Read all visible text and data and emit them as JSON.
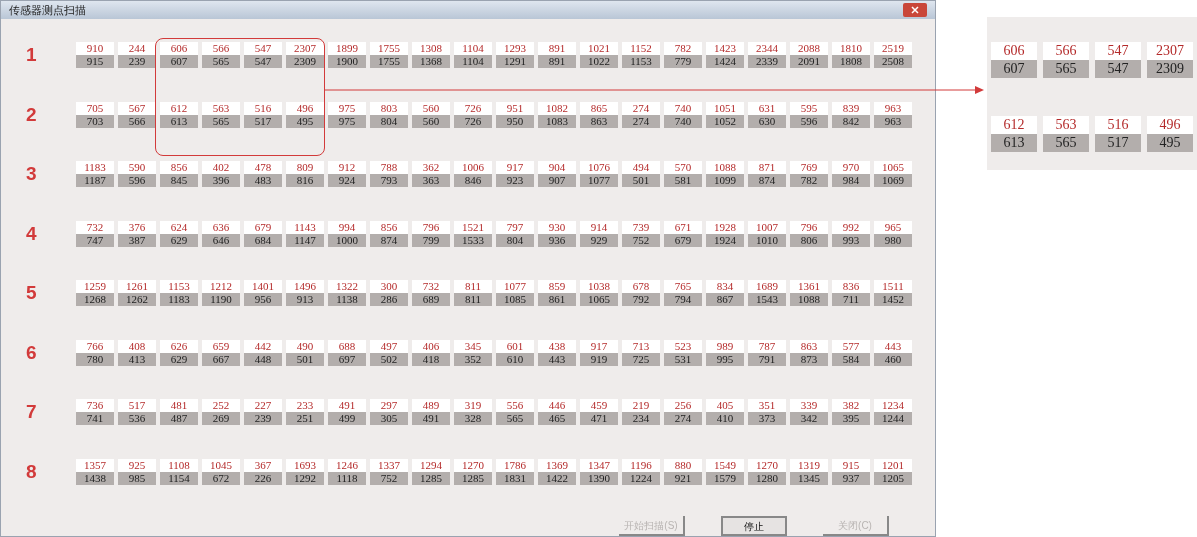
{
  "window": {
    "title": "传感器测点扫描"
  },
  "rows": [
    {
      "label": "1",
      "cells": [
        [
          "910",
          "915"
        ],
        [
          "244",
          "239"
        ],
        [
          "606",
          "607"
        ],
        [
          "566",
          "565"
        ],
        [
          "547",
          "547"
        ],
        [
          "2307",
          "2309"
        ],
        [
          "1899",
          "1900"
        ],
        [
          "1755",
          "1755"
        ],
        [
          "1308",
          "1368"
        ],
        [
          "1104",
          "1104"
        ],
        [
          "1293",
          "1291"
        ],
        [
          "891",
          "891"
        ],
        [
          "1021",
          "1022"
        ],
        [
          "1152",
          "1153"
        ],
        [
          "782",
          "779"
        ],
        [
          "1423",
          "1424"
        ],
        [
          "2344",
          "2339"
        ],
        [
          "2088",
          "2091"
        ],
        [
          "1810",
          "1808"
        ],
        [
          "2519",
          "2508"
        ]
      ]
    },
    {
      "label": "2",
      "cells": [
        [
          "705",
          "703"
        ],
        [
          "567",
          "566"
        ],
        [
          "612",
          "613"
        ],
        [
          "563",
          "565"
        ],
        [
          "516",
          "517"
        ],
        [
          "496",
          "495"
        ],
        [
          "975",
          "975"
        ],
        [
          "803",
          "804"
        ],
        [
          "560",
          "560"
        ],
        [
          "726",
          "726"
        ],
        [
          "951",
          "950"
        ],
        [
          "1082",
          "1083"
        ],
        [
          "865",
          "863"
        ],
        [
          "274",
          "274"
        ],
        [
          "740",
          "740"
        ],
        [
          "1051",
          "1052"
        ],
        [
          "631",
          "630"
        ],
        [
          "595",
          "596"
        ],
        [
          "839",
          "842"
        ],
        [
          "963",
          "963"
        ]
      ]
    },
    {
      "label": "3",
      "cells": [
        [
          "1183",
          "1187"
        ],
        [
          "590",
          "596"
        ],
        [
          "856",
          "845"
        ],
        [
          "402",
          "396"
        ],
        [
          "478",
          "483"
        ],
        [
          "809",
          "816"
        ],
        [
          "912",
          "924"
        ],
        [
          "788",
          "793"
        ],
        [
          "362",
          "363"
        ],
        [
          "1006",
          "846"
        ],
        [
          "917",
          "923"
        ],
        [
          "904",
          "907"
        ],
        [
          "1076",
          "1077"
        ],
        [
          "494",
          "501"
        ],
        [
          "570",
          "581"
        ],
        [
          "1088",
          "1099"
        ],
        [
          "871",
          "874"
        ],
        [
          "769",
          "782"
        ],
        [
          "970",
          "984"
        ],
        [
          "1065",
          "1069"
        ]
      ]
    },
    {
      "label": "4",
      "cells": [
        [
          "732",
          "747"
        ],
        [
          "376",
          "387"
        ],
        [
          "624",
          "629"
        ],
        [
          "636",
          "646"
        ],
        [
          "679",
          "684"
        ],
        [
          "1143",
          "1147"
        ],
        [
          "994",
          "1000"
        ],
        [
          "856",
          "874"
        ],
        [
          "796",
          "799"
        ],
        [
          "1521",
          "1533"
        ],
        [
          "797",
          "804"
        ],
        [
          "930",
          "936"
        ],
        [
          "914",
          "929"
        ],
        [
          "739",
          "752"
        ],
        [
          "671",
          "679"
        ],
        [
          "1928",
          "1924"
        ],
        [
          "1007",
          "1010"
        ],
        [
          "796",
          "806"
        ],
        [
          "992",
          "993"
        ],
        [
          "965",
          "980"
        ]
      ]
    },
    {
      "label": "5",
      "cells": [
        [
          "1259",
          "1268"
        ],
        [
          "1261",
          "1262"
        ],
        [
          "1153",
          "1183"
        ],
        [
          "1212",
          "1190"
        ],
        [
          "1401",
          "956"
        ],
        [
          "1496",
          "913"
        ],
        [
          "1322",
          "1138"
        ],
        [
          "300",
          "286"
        ],
        [
          "732",
          "689"
        ],
        [
          "811",
          "811"
        ],
        [
          "1077",
          "1085"
        ],
        [
          "859",
          "861"
        ],
        [
          "1038",
          "1065"
        ],
        [
          "678",
          "792"
        ],
        [
          "765",
          "794"
        ],
        [
          "834",
          "867"
        ],
        [
          "1689",
          "1543"
        ],
        [
          "1361",
          "1088"
        ],
        [
          "836",
          "711"
        ],
        [
          "1511",
          "1452"
        ]
      ]
    },
    {
      "label": "6",
      "cells": [
        [
          "766",
          "780"
        ],
        [
          "408",
          "413"
        ],
        [
          "626",
          "629"
        ],
        [
          "659",
          "667"
        ],
        [
          "442",
          "448"
        ],
        [
          "490",
          "501"
        ],
        [
          "688",
          "697"
        ],
        [
          "497",
          "502"
        ],
        [
          "406",
          "418"
        ],
        [
          "345",
          "352"
        ],
        [
          "601",
          "610"
        ],
        [
          "438",
          "443"
        ],
        [
          "917",
          "919"
        ],
        [
          "713",
          "725"
        ],
        [
          "523",
          "531"
        ],
        [
          "989",
          "995"
        ],
        [
          "787",
          "791"
        ],
        [
          "863",
          "873"
        ],
        [
          "577",
          "584"
        ],
        [
          "443",
          "460"
        ]
      ]
    },
    {
      "label": "7",
      "cells": [
        [
          "736",
          "741"
        ],
        [
          "517",
          "536"
        ],
        [
          "481",
          "487"
        ],
        [
          "252",
          "269"
        ],
        [
          "227",
          "239"
        ],
        [
          "233",
          "251"
        ],
        [
          "491",
          "499"
        ],
        [
          "297",
          "305"
        ],
        [
          "489",
          "491"
        ],
        [
          "319",
          "328"
        ],
        [
          "556",
          "565"
        ],
        [
          "446",
          "465"
        ],
        [
          "459",
          "471"
        ],
        [
          "219",
          "234"
        ],
        [
          "256",
          "274"
        ],
        [
          "405",
          "410"
        ],
        [
          "351",
          "373"
        ],
        [
          "339",
          "342"
        ],
        [
          "382",
          "395"
        ],
        [
          "1234",
          "1244"
        ]
      ]
    },
    {
      "label": "8",
      "cells": [
        [
          "1357",
          "1438"
        ],
        [
          "925",
          "985"
        ],
        [
          "1108",
          "1154"
        ],
        [
          "1045",
          "672"
        ],
        [
          "367",
          "226"
        ],
        [
          "1693",
          "1292"
        ],
        [
          "1246",
          "1118"
        ],
        [
          "1337",
          "752"
        ],
        [
          "1294",
          "1285"
        ],
        [
          "1270",
          "1285"
        ],
        [
          "1786",
          "1831"
        ],
        [
          "1369",
          "1422"
        ],
        [
          "1347",
          "1390"
        ],
        [
          "1196",
          "1224"
        ],
        [
          "880",
          "921"
        ],
        [
          "1549",
          "1579"
        ],
        [
          "1270",
          "1280"
        ],
        [
          "1319",
          "1345"
        ],
        [
          "915",
          "937"
        ],
        [
          "1201",
          "1205"
        ]
      ]
    }
  ],
  "buttons": [
    {
      "label": "开始扫描(S)",
      "disabled": true
    },
    {
      "label": "停止",
      "disabled": false
    },
    {
      "label": "关闭(C)",
      "disabled": true
    }
  ],
  "zoom_inset": {
    "rows": [
      {
        "cells": [
          [
            "606",
            "607"
          ],
          [
            "566",
            "565"
          ],
          [
            "547",
            "547"
          ],
          [
            "2307",
            "2309"
          ]
        ]
      },
      {
        "cells": [
          [
            "612",
            "613"
          ],
          [
            "563",
            "565"
          ],
          [
            "516",
            "517"
          ],
          [
            "496",
            "495"
          ]
        ]
      }
    ]
  }
}
